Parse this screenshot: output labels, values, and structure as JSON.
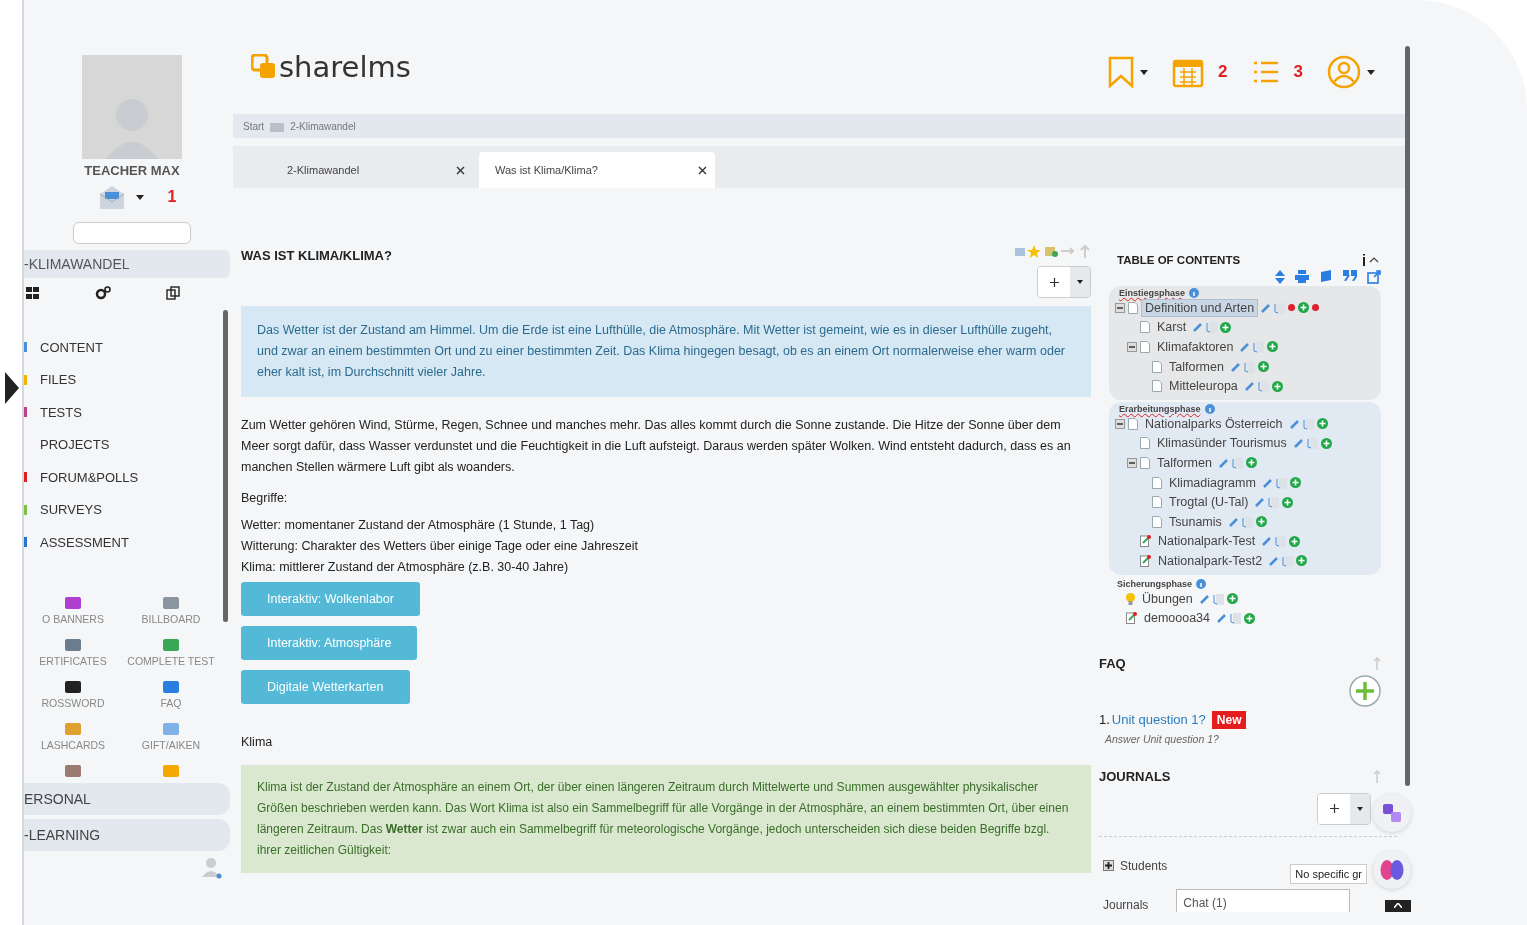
{
  "sidebar": {
    "user": {
      "name": "TEACHER MAX"
    },
    "messages_count": "1",
    "course": "-KLIMAWANDEL",
    "menu": [
      {
        "label": "CONTENT",
        "color": "#4a90d9"
      },
      {
        "label": "FILES",
        "color": "#f0b400"
      },
      {
        "label": "TESTS",
        "color": "#c2408a"
      },
      {
        "label": "PROJECTS"
      },
      {
        "label": "FORUM&POLLS",
        "color": "#e02020"
      },
      {
        "label": "SURVEYS",
        "color": "#7cc242"
      },
      {
        "label": "ASSESSMENT",
        "color": "#2a6fd6"
      }
    ],
    "tools": [
      {
        "label": "O BANNERS",
        "color": "#b03fd0"
      },
      {
        "label": "BILLBOARD",
        "color": "#8a95a0"
      },
      {
        "label": "ERTIFICATES",
        "color": "#6b7c8f"
      },
      {
        "label": "COMPLETE TEST",
        "color": "#3aa757"
      },
      {
        "label": "ROSSWORD",
        "color": "#222222"
      },
      {
        "label": "FAQ",
        "color": "#2a7de1"
      },
      {
        "label": "LASHCARDS",
        "color": "#e0a030"
      },
      {
        "label": "GIFT/AIKEN",
        "color": "#7fb0e6"
      },
      {
        "color": "#9a7b70"
      },
      {
        "color": "#f4a900"
      }
    ],
    "sections": [
      "ERSONAL",
      "-LEARNING"
    ]
  },
  "header": {
    "logo": "sharelms",
    "calendar_count": "2",
    "tasks_count": "3"
  },
  "breadcrumb": [
    "Start",
    "2-Klimawandel"
  ],
  "tabs": [
    {
      "label": "2-Klimawandel",
      "selected": false
    },
    {
      "label": "Was ist Klima/Klima?",
      "selected": true
    }
  ],
  "article": {
    "title": "WAS IST KLIMA/KLIMA?",
    "info_box": "Das Wetter ist der Zustand am Himmel. Um die Erde ist eine Lufthülle, die Atmosphäre. Mit Wetter ist gemeint, wie es in dieser Lufthülle zugeht, und zwar an einem bestimmten Ort und zu einer bestimmten Zeit. Das Klima hingegen besagt, ob es an einem Ort normalerweise eher warm oder eher kalt ist, im Durchschnitt vieler Jahre.",
    "paragraph": "Zum Wetter gehören Wind, Stürme, Regen, Schnee und manches mehr. Das alles kommt durch die Sonne zustande. Die Hitze der Sonne über dem Meer sorgt dafür, dass Wasser verdunstet und die Feuchtigkeit in die Luft aufsteigt. Daraus werden später Wolken. Wind entsteht dadurch, dass es an manchen Stellen wärmere Luft gibt als woanders.",
    "terms_heading": "Begriffe:",
    "terms": [
      "Wetter: momentaner Zustand der Atmosphäre (1 Stunde, 1 Tag)",
      "Witterung: Charakter des Wetters über einige Tage oder eine Jahreszeit",
      "Klima: mittlerer Zustand der Atmosphäre (z.B. 30-40 Jahre)"
    ],
    "buttons": [
      "Interaktiv: Wolkenlabor",
      "Interaktiv: Atmosphäre",
      "Digitale Wetterkarten"
    ],
    "section_heading": "Klima",
    "green_box": "Klima ist der Zustand der Atmosphäre an einem Ort, der über einen längeren Zeitraum durch Mittelwerte und Summen ausgewählter physikalischer Größen beschrieben werden kann. Das Wort Klima ist also ein Sammelbegriff für alle Vorgänge in der Atmosphäre, an einem bestimmten Ort, über einen längeren Zeitraum. Das **Wetter** ist zwar auch ein Sammelbegriff für meteorologische Vorgänge, jedoch unterscheiden sich diese beiden Begriffe bzgl. ihrer zeitlichen Gültigkeit:"
  },
  "toc": {
    "title": "TABLE OF CONTENTS",
    "phases": [
      {
        "title": "Einstiegsphase",
        "color": "#e6e7e8",
        "items": [
          {
            "label": "Definition und Arten",
            "kind": "page",
            "selected": true,
            "flagged": true,
            "expanded": true,
            "children": [
              {
                "label": "Karst",
                "kind": "page",
                "selected": false,
                "flagged": false
              },
              {
                "label": "Klimafaktoren",
                "kind": "page",
                "selected": false,
                "flagged": false,
                "expanded": true,
                "children": [
                  {
                    "label": "Talformen",
                    "kind": "page",
                    "selected": false,
                    "flagged": false
                  },
                  {
                    "label": "Mitteleuropa",
                    "kind": "page",
                    "selected": false,
                    "flagged": false
                  }
                ]
              }
            ]
          }
        ]
      },
      {
        "title": "Erarbeitungsphase",
        "color": "#e1e9f3",
        "items": [
          {
            "label": "Nationalparks Österreich",
            "kind": "page",
            "selected": false,
            "flagged": false,
            "expanded": true,
            "children": [
              {
                "label": "Klimasünder Tourismus",
                "kind": "page",
                "selected": false,
                "flagged": false
              },
              {
                "label": "Talformen",
                "kind": "page",
                "selected": false,
                "flagged": false,
                "expanded": true,
                "children": [
                  {
                    "label": "Klimadiagramm",
                    "kind": "page",
                    "selected": false,
                    "flagged": false
                  },
                  {
                    "label": "Trogtal (U-Tal)",
                    "kind": "page",
                    "selected": false,
                    "flagged": false
                  },
                  {
                    "label": "Tsunamis",
                    "kind": "page",
                    "selected": false,
                    "flagged": false
                  }
                ]
              },
              {
                "label": "Nationalpark-Test",
                "kind": "test",
                "selected": false,
                "flagged": false
              },
              {
                "label": "Nationalpark-Test2",
                "kind": "test",
                "selected": false,
                "flagged": false
              }
            ]
          }
        ]
      },
      {
        "title": "Sicherungsphase",
        "items": [
          {
            "label": "Übungen",
            "kind": "idea",
            "selected": false,
            "flagged": false
          },
          {
            "label": "demoooa34",
            "kind": "test",
            "selected": false,
            "flagged": false
          }
        ]
      }
    ]
  },
  "faq": {
    "title": "FAQ",
    "items": [
      {
        "number": "1.",
        "question": "Unit question 1?",
        "badge": "New",
        "answer": "Answer Unit question 1?"
      }
    ]
  },
  "journals": {
    "title": "JOURNALS",
    "group_label": "Students",
    "expanded": false,
    "filter": "No specific gr",
    "list_label": "Journals"
  },
  "chat": {
    "label": "Chat (1)"
  }
}
